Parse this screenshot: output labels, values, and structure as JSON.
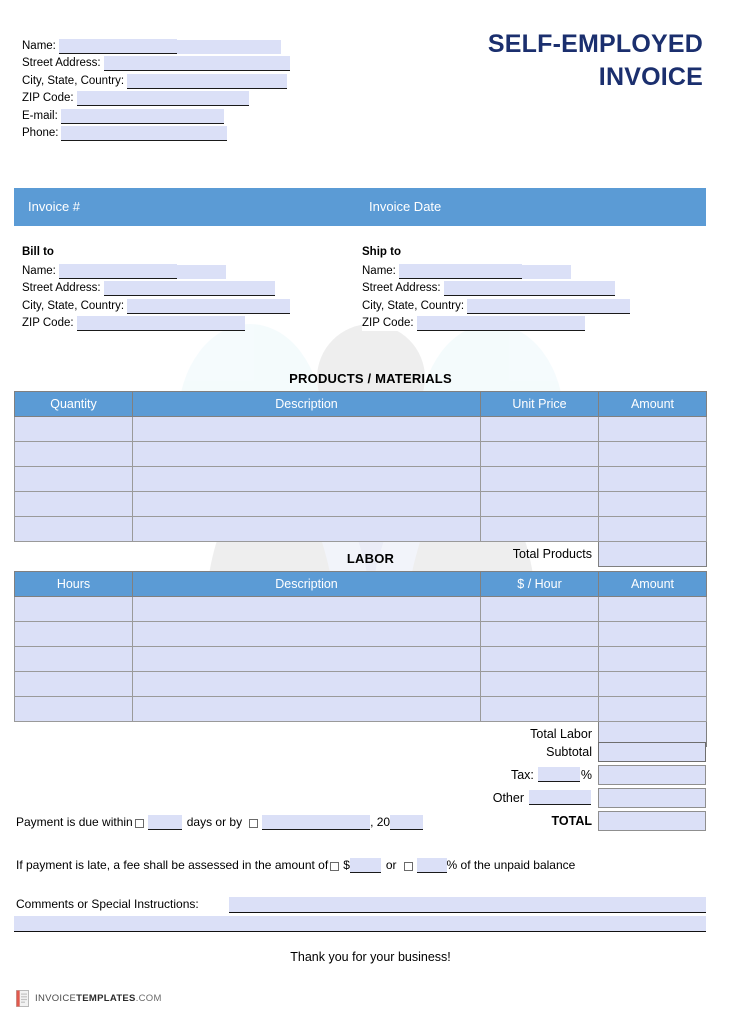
{
  "document": {
    "title_line_1": "SELF-EMPLOYED",
    "title_line_2": "INVOICE"
  },
  "colors": {
    "banner_blue": "#5b9bd5",
    "field_fill": "#dbe0f7",
    "title_navy": "#1b2f6e"
  },
  "sender": {
    "fields": [
      {
        "label": "Name:",
        "value": ""
      },
      {
        "label": "Street Address:",
        "value": ""
      },
      {
        "label": "City, State, Country:",
        "value": ""
      },
      {
        "label": "ZIP Code:",
        "value": ""
      },
      {
        "label": "E-mail:",
        "value": ""
      },
      {
        "label": "Phone:",
        "value": ""
      }
    ]
  },
  "banner": {
    "invoice_number_label": "Invoice #",
    "invoice_date_label": "Invoice Date",
    "invoice_number_value": "",
    "invoice_date_value": ""
  },
  "bill_to": {
    "title": "Bill to",
    "fields": [
      {
        "label": "Name:",
        "value": ""
      },
      {
        "label": "Street Address:",
        "value": ""
      },
      {
        "label": "City, State, Country:",
        "value": ""
      },
      {
        "label": "ZIP Code:",
        "value": ""
      }
    ]
  },
  "ship_to": {
    "title": "Ship to",
    "fields": [
      {
        "label": "Name:",
        "value": ""
      },
      {
        "label": "Street Address:",
        "value": ""
      },
      {
        "label": "City, State, Country:",
        "value": ""
      },
      {
        "label": "ZIP Code:",
        "value": ""
      }
    ]
  },
  "products_section": {
    "title": "PRODUCTS / MATERIALS",
    "columns": [
      "Quantity",
      "Description",
      "Unit Price",
      "Amount"
    ],
    "rows": [
      {
        "quantity": "",
        "description": "",
        "unit_price": "",
        "amount": ""
      },
      {
        "quantity": "",
        "description": "",
        "unit_price": "",
        "amount": ""
      },
      {
        "quantity": "",
        "description": "",
        "unit_price": "",
        "amount": ""
      },
      {
        "quantity": "",
        "description": "",
        "unit_price": "",
        "amount": ""
      },
      {
        "quantity": "",
        "description": "",
        "unit_price": "",
        "amount": ""
      }
    ],
    "total_label": "Total Products",
    "total_value": ""
  },
  "labor_section": {
    "title": "LABOR",
    "columns": [
      "Hours",
      "Description",
      "$ / Hour",
      "Amount"
    ],
    "rows": [
      {
        "hours": "",
        "description": "",
        "rate": "",
        "amount": ""
      },
      {
        "hours": "",
        "description": "",
        "rate": "",
        "amount": ""
      },
      {
        "hours": "",
        "description": "",
        "rate": "",
        "amount": ""
      },
      {
        "hours": "",
        "description": "",
        "rate": "",
        "amount": ""
      },
      {
        "hours": "",
        "description": "",
        "rate": "",
        "amount": ""
      }
    ],
    "total_label": "Total Labor",
    "total_value": ""
  },
  "totals": {
    "subtotal_label": "Subtotal",
    "subtotal_value": "",
    "tax_label": "Tax:",
    "tax_percent_value": "",
    "tax_percent_symbol": "%",
    "tax_value": "",
    "other_label": "Other",
    "other_name_value": "",
    "other_value": "",
    "total_label": "TOTAL",
    "total_value": ""
  },
  "terms": {
    "due_prefix": "Payment is due within",
    "due_days_value": "",
    "due_middle": "days or by",
    "due_date_value": "",
    "due_year_prefix": ", 20",
    "due_year_value": "",
    "late_prefix": "If payment is late, a fee shall be assessed in the amount of",
    "late_dollar_sign": "$",
    "late_dollar_value": "",
    "late_or": "or",
    "late_percent_value": "",
    "late_percent_suffix": "% of the unpaid balance"
  },
  "comments": {
    "label": "Comments or Special Instructions:",
    "line_1_value": "",
    "line_2_value": ""
  },
  "closing": {
    "thanks": "Thank you for your business!"
  },
  "footer": {
    "logo_word_1": "INVOICE",
    "logo_word_2": "TEMPLATES",
    "logo_word_3": ".COM"
  }
}
